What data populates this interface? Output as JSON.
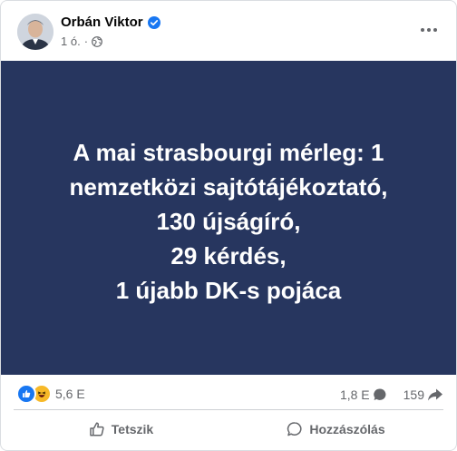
{
  "post": {
    "author": "Orbán Viktor",
    "time": "1 ó."
  },
  "panel": {
    "lines": [
      "A mai strasbourgi mérleg: 1",
      "nemzetközi sajtótájékoztató,",
      "130 újságíró,",
      "29 kérdés,",
      "1 újabb DK-s pojáca"
    ],
    "background": "#27365f",
    "text_color": "#ffffff"
  },
  "stats": {
    "reactions": "5,6 E",
    "comments": "1,8 E",
    "shares": "159"
  },
  "actions": {
    "like": "Tetszik",
    "comment": "Hozzászólás"
  },
  "colors": {
    "verified": "#1877f2",
    "secondary_text": "#65676b"
  }
}
